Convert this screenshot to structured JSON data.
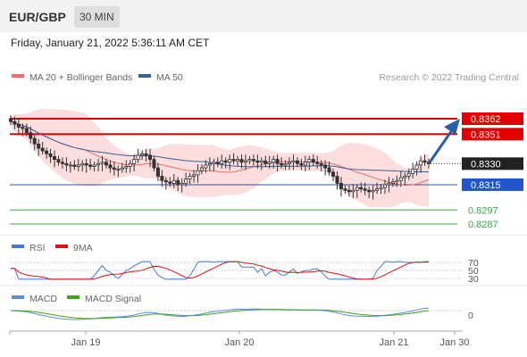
{
  "header": {
    "pair": "EUR/GBP",
    "timeframe": "30 MIN",
    "datetime": "Friday, January 21, 2022 5:36:11 AM CET"
  },
  "colors": {
    "bollinger": "#f26b6b",
    "ma50": "#3b5e9c",
    "resistance": "#e50000",
    "support": "#2255cc",
    "target": "#3fa34d",
    "price_label": "#222222",
    "rsi": "#4a77d4",
    "rsi_ma": "#e01010",
    "macd": "#5b8ee0",
    "macd_signal": "#41a318",
    "arrow": "#2a5ca8"
  },
  "chart_data": [
    {
      "type": "candlestick",
      "title": "EUR/GBP",
      "legend": [
        "MA 20 + Bollinger Bands",
        "MA 50"
      ],
      "credit": "Research © 2022 Trading Central",
      "x_ticks": [
        "Jan 19",
        "Jan 20",
        "Jan 21",
        "Jan 30"
      ],
      "y_range": [
        0.8282,
        0.8368
      ],
      "levels": [
        {
          "label": "0.8362",
          "value": 0.8362,
          "kind": "resistance"
        },
        {
          "label": "0.8351",
          "value": 0.8351,
          "kind": "resistance"
        },
        {
          "label": "0.8330",
          "value": 0.833,
          "kind": "last"
        },
        {
          "label": "0.8315",
          "value": 0.8315,
          "kind": "support"
        },
        {
          "label": "0.8297",
          "value": 0.8297,
          "kind": "target"
        },
        {
          "label": "0.8287",
          "value": 0.8287,
          "kind": "target"
        }
      ],
      "close": [
        0.836,
        0.8358,
        0.8356,
        0.8355,
        0.8352,
        0.8348,
        0.8344,
        0.8341,
        0.8339,
        0.8337,
        0.8335,
        0.8333,
        0.8331,
        0.833,
        0.8329,
        0.8329,
        0.8328,
        0.8329,
        0.833,
        0.8329,
        0.8328,
        0.8329,
        0.833,
        0.8331,
        0.8329,
        0.8327,
        0.8326,
        0.8326,
        0.8327,
        0.8328,
        0.833,
        0.8333,
        0.8336,
        0.8337,
        0.8336,
        0.8333,
        0.8327,
        0.8321,
        0.8318,
        0.8317,
        0.8316,
        0.8318,
        0.8315,
        0.8316,
        0.8319,
        0.8321,
        0.8322,
        0.8325,
        0.8327,
        0.8329,
        0.833,
        0.8331,
        0.833,
        0.8332,
        0.8331,
        0.8333,
        0.8332,
        0.8333,
        0.8331,
        0.8332,
        0.8333,
        0.8332,
        0.8331,
        0.8332,
        0.833,
        0.8331,
        0.8333,
        0.833,
        0.8329,
        0.833,
        0.8331,
        0.8332,
        0.833,
        0.8329,
        0.8331,
        0.8333,
        0.8331,
        0.833,
        0.8329,
        0.8327,
        0.8324,
        0.8321,
        0.8316,
        0.8312,
        0.8311,
        0.831,
        0.8311,
        0.8313,
        0.8312,
        0.8311,
        0.831,
        0.8311,
        0.8312,
        0.8313,
        0.8315,
        0.8316,
        0.8317,
        0.8318,
        0.832,
        0.8321,
        0.8323,
        0.8326,
        0.8329,
        0.8332,
        0.8331,
        0.833
      ]
    },
    {
      "type": "line",
      "title": "RSI",
      "series": [
        {
          "name": "RSI"
        },
        {
          "name": "9MA"
        }
      ],
      "y_ticks": [
        70,
        50,
        30
      ]
    },
    {
      "type": "line",
      "title": "MACD",
      "series": [
        {
          "name": "MACD"
        },
        {
          "name": "MACD Signal"
        }
      ],
      "y_ticks": [
        0
      ]
    }
  ]
}
